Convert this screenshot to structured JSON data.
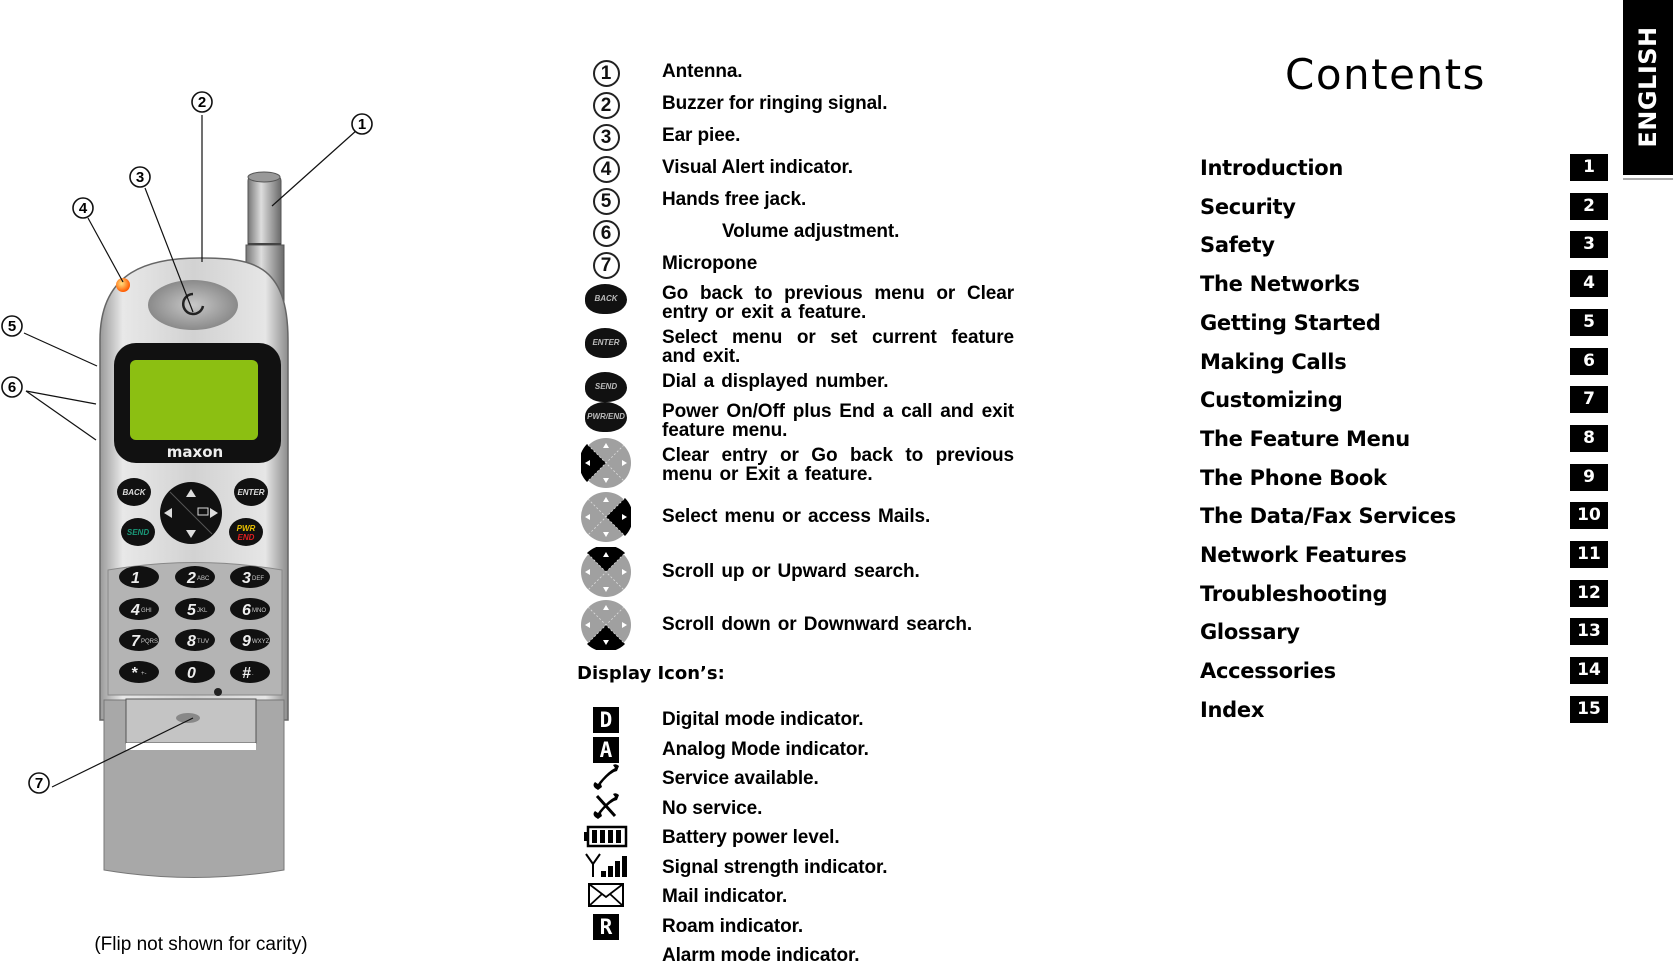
{
  "figure": {
    "brand": "maxon",
    "caption": "(Flip not shown for carity)",
    "callouts": [
      "1",
      "2",
      "3",
      "4",
      "5",
      "6",
      "7"
    ],
    "keys": {
      "back": "BACK",
      "enter": "ENTER",
      "send": "SEND",
      "pwr": "PWR",
      "end": "END",
      "keypad": [
        {
          "digit": "1",
          "letters": ""
        },
        {
          "digit": "2",
          "letters": "ABC"
        },
        {
          "digit": "3",
          "letters": "DEF"
        },
        {
          "digit": "4",
          "letters": "GHI"
        },
        {
          "digit": "5",
          "letters": "JKL"
        },
        {
          "digit": "6",
          "letters": "MNO"
        },
        {
          "digit": "7",
          "letters": "PQRS"
        },
        {
          "digit": "8",
          "letters": "TUV"
        },
        {
          "digit": "9",
          "letters": "WXYZ"
        },
        {
          "digit": "*",
          "letters": "+-"
        },
        {
          "digit": "0",
          "letters": ""
        },
        {
          "digit": "#",
          "letters": "."
        }
      ]
    },
    "colors": {
      "lcd": "#8cbf12",
      "led": "#ff6a00",
      "send_text": "#1a9a7a",
      "pwr_text": "#e8c000",
      "end_text": "#e02020"
    }
  },
  "parts_legend": [
    {
      "icon": "circled-1",
      "marker": "1",
      "text": "Antenna."
    },
    {
      "icon": "circled-2",
      "marker": "2",
      "text": "Buzzer for ringing signal."
    },
    {
      "icon": "circled-3",
      "marker": "3",
      "text": "Ear piee."
    },
    {
      "icon": "circled-4",
      "marker": "4",
      "text": "Visual Alert indicator."
    },
    {
      "icon": "circled-5",
      "marker": "5",
      "text": "Hands free jack."
    },
    {
      "icon": "circled-6",
      "marker": "6",
      "text": "Volume adjustment."
    },
    {
      "icon": "circled-7",
      "marker": "7",
      "text": "Micropone"
    }
  ],
  "keys_legend": [
    {
      "icon": "back-key",
      "key_label": "BACK",
      "text": "Go back to previous menu or Clear entry or exit a feature."
    },
    {
      "icon": "enter-key",
      "key_label": "ENTER",
      "text": "Select menu or set current feature and exit."
    },
    {
      "icon": "send-key",
      "key_label": "SEND",
      "text": "Dial a displayed number."
    },
    {
      "icon": "pwr-end-key",
      "key_label": "PWR/END",
      "text": "Power On/Off plus End a call and exit feature menu."
    },
    {
      "icon": "nav-left-key",
      "text": "Clear entry or Go back to previous menu or Exit a feature."
    },
    {
      "icon": "nav-right-key",
      "text": "Select menu or access Mails."
    },
    {
      "icon": "nav-up-key",
      "text": "Scroll up or Upward search."
    },
    {
      "icon": "nav-down-key",
      "text": "Scroll down or Downward search."
    }
  ],
  "display_icons": {
    "title": "Display Icon’s:",
    "items": [
      {
        "icon": "digital-mode-icon",
        "glyph": "D",
        "text": "Digital mode indicator."
      },
      {
        "icon": "analog-mode-icon",
        "glyph": "A",
        "text": "Analog Mode indicator."
      },
      {
        "icon": "service-available-icon",
        "text": "Service available."
      },
      {
        "icon": "no-service-icon",
        "text": "No service."
      },
      {
        "icon": "battery-icon",
        "text": "Battery power level."
      },
      {
        "icon": "signal-strength-icon",
        "text": "Signal strength indicator."
      },
      {
        "icon": "mail-icon",
        "text": "Mail indicator."
      },
      {
        "icon": "roam-icon",
        "glyph": "R",
        "text": "Roam indicator."
      },
      {
        "icon": "alarm-icon",
        "text": "Alarm mode indicator."
      }
    ]
  },
  "contents": {
    "title": "Contents",
    "language_tab": "ENGLISH",
    "items": [
      {
        "label": "Introduction",
        "page": "1"
      },
      {
        "label": "Security",
        "page": "2"
      },
      {
        "label": "Safety",
        "page": "3"
      },
      {
        "label": "The Networks",
        "page": "4"
      },
      {
        "label": "Getting Started",
        "page": "5"
      },
      {
        "label": "Making Calls",
        "page": "6"
      },
      {
        "label": "Customizing",
        "page": "7"
      },
      {
        "label": "The Feature Menu",
        "page": "8"
      },
      {
        "label": "The Phone Book",
        "page": "9"
      },
      {
        "label": "The Data/Fax Services",
        "page": "10"
      },
      {
        "label": "Network Features",
        "page": "11"
      },
      {
        "label": "Troubleshooting",
        "page": "12"
      },
      {
        "label": "Glossary",
        "page": "13"
      },
      {
        "label": "Accessories",
        "page": "14"
      },
      {
        "label": "Index",
        "page": "15"
      }
    ]
  }
}
